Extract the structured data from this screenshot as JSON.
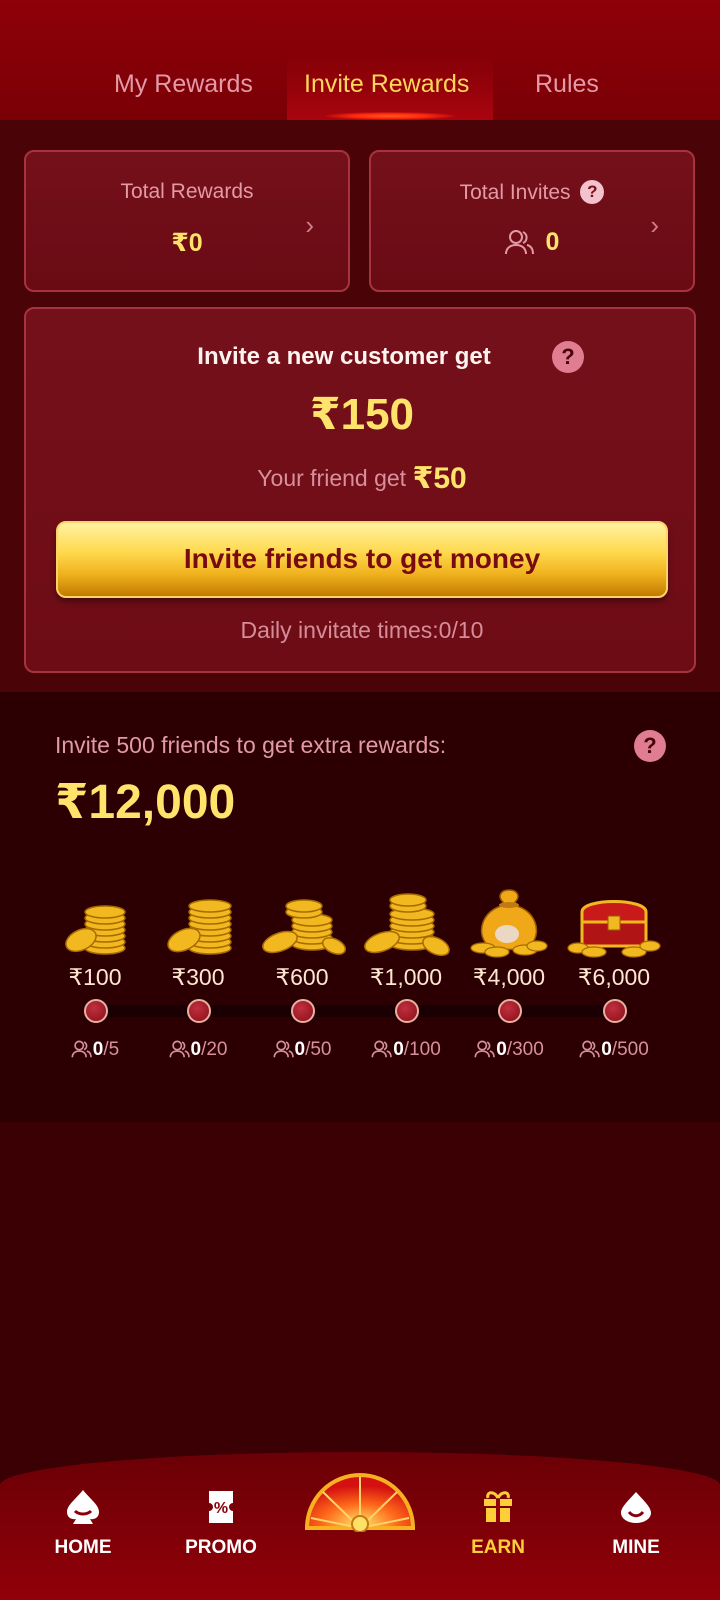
{
  "tabs": [
    {
      "label": "My Rewards",
      "active": false
    },
    {
      "label": "Invite Rewards",
      "active": true
    },
    {
      "label": "Rules",
      "active": false
    }
  ],
  "stats": {
    "total_rewards": {
      "label": "Total Rewards",
      "value": "₹0"
    },
    "total_invites": {
      "label": "Total Invites",
      "value": "0"
    }
  },
  "invite": {
    "title": "Invite a new customer get",
    "amount": "₹150",
    "friend_text": "Your friend get",
    "friend_amount": "₹50",
    "button_label": "Invite friends to get money",
    "daily_text": "Daily invitate times:0/10"
  },
  "extra": {
    "title": "Invite 500 friends to get extra rewards:",
    "amount": "₹12,000",
    "tiers": [
      {
        "amount": "₹100",
        "current": "0",
        "target": "/5",
        "icon": "coin-stack-small"
      },
      {
        "amount": "₹300",
        "current": "0",
        "target": "/20",
        "icon": "coin-stack-medium"
      },
      {
        "amount": "₹600",
        "current": "0",
        "target": "/50",
        "icon": "coin-pile"
      },
      {
        "amount": "₹1,000",
        "current": "0",
        "target": "/100",
        "icon": "coin-pile-large"
      },
      {
        "amount": "₹4,000",
        "current": "0",
        "target": "/300",
        "icon": "money-bag"
      },
      {
        "amount": "₹6,000",
        "current": "0",
        "target": "/500",
        "icon": "treasure-chest"
      }
    ]
  },
  "nav": {
    "items": [
      {
        "label": "HOME",
        "icon": "spade-icon"
      },
      {
        "label": "PROMO",
        "icon": "ticket-icon"
      },
      {
        "label": "EARN",
        "icon": "gift-icon",
        "active": true
      },
      {
        "label": "MINE",
        "icon": "drop-icon"
      }
    ]
  },
  "colors": {
    "accent": "#ffd65a",
    "card_bg": "#74101a",
    "button_gold": "#ffd94e"
  }
}
